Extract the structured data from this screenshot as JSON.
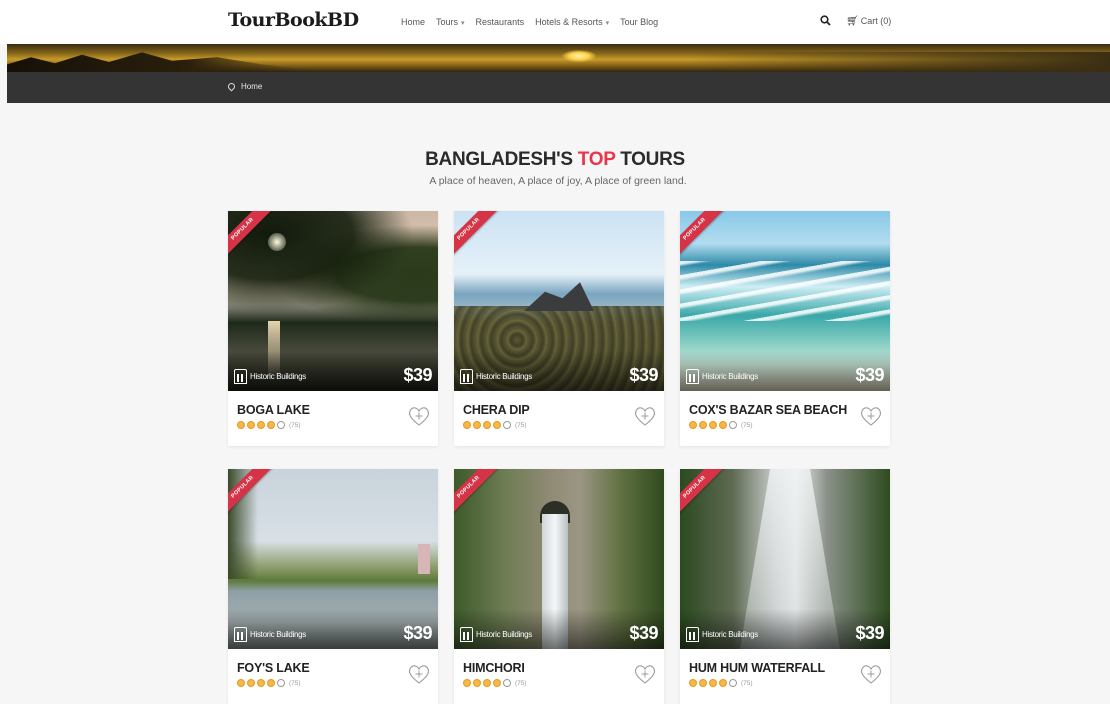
{
  "brand": {
    "logo": "TourBookBD"
  },
  "nav": {
    "items": [
      {
        "label": "Home",
        "dropdown": false
      },
      {
        "label": "Tours",
        "dropdown": true
      },
      {
        "label": "Restaurants",
        "dropdown": false
      },
      {
        "label": "Hotels & Resorts",
        "dropdown": true
      },
      {
        "label": "Tour Blog",
        "dropdown": false
      }
    ],
    "search_icon": "search-icon",
    "cart_label": "Cart (0)"
  },
  "breadcrumb": {
    "label": "Home"
  },
  "section": {
    "title_pre": "BANGLADESH'S ",
    "title_highlight": "TOP",
    "title_post": " TOURS",
    "highlight_color": "#e8374c",
    "subtitle": "A place of heaven, A place of joy, A place of green land."
  },
  "tours": [
    {
      "name": "BOGA LAKE",
      "category": "Historic Buildings",
      "price": "$39",
      "badge": "POPULAR",
      "rating": 4,
      "reviews": "(75)"
    },
    {
      "name": "CHERA DIP",
      "category": "Historic Buildings",
      "price": "$39",
      "badge": "POPULAR",
      "rating": 4,
      "reviews": "(75)"
    },
    {
      "name": "COX'S BAZAR SEA BEACH",
      "category": "Historic Buildings",
      "price": "$39",
      "badge": "POPULAR",
      "rating": 4,
      "reviews": "(75)"
    },
    {
      "name": "FOY'S LAKE",
      "category": "Historic Buildings",
      "price": "$39",
      "badge": "POPULAR",
      "rating": 4,
      "reviews": "(75)"
    },
    {
      "name": "HIMCHORI",
      "category": "Historic Buildings",
      "price": "$39",
      "badge": "POPULAR",
      "rating": 4,
      "reviews": "(75)"
    },
    {
      "name": "HUM HUM WATERFALL",
      "category": "Historic Buildings",
      "price": "$39",
      "badge": "POPULAR",
      "rating": 4,
      "reviews": "(75)"
    }
  ],
  "colors": {
    "ribbon": "#d63346",
    "star": "#f6b64a",
    "crumb_bar": "#343434"
  }
}
